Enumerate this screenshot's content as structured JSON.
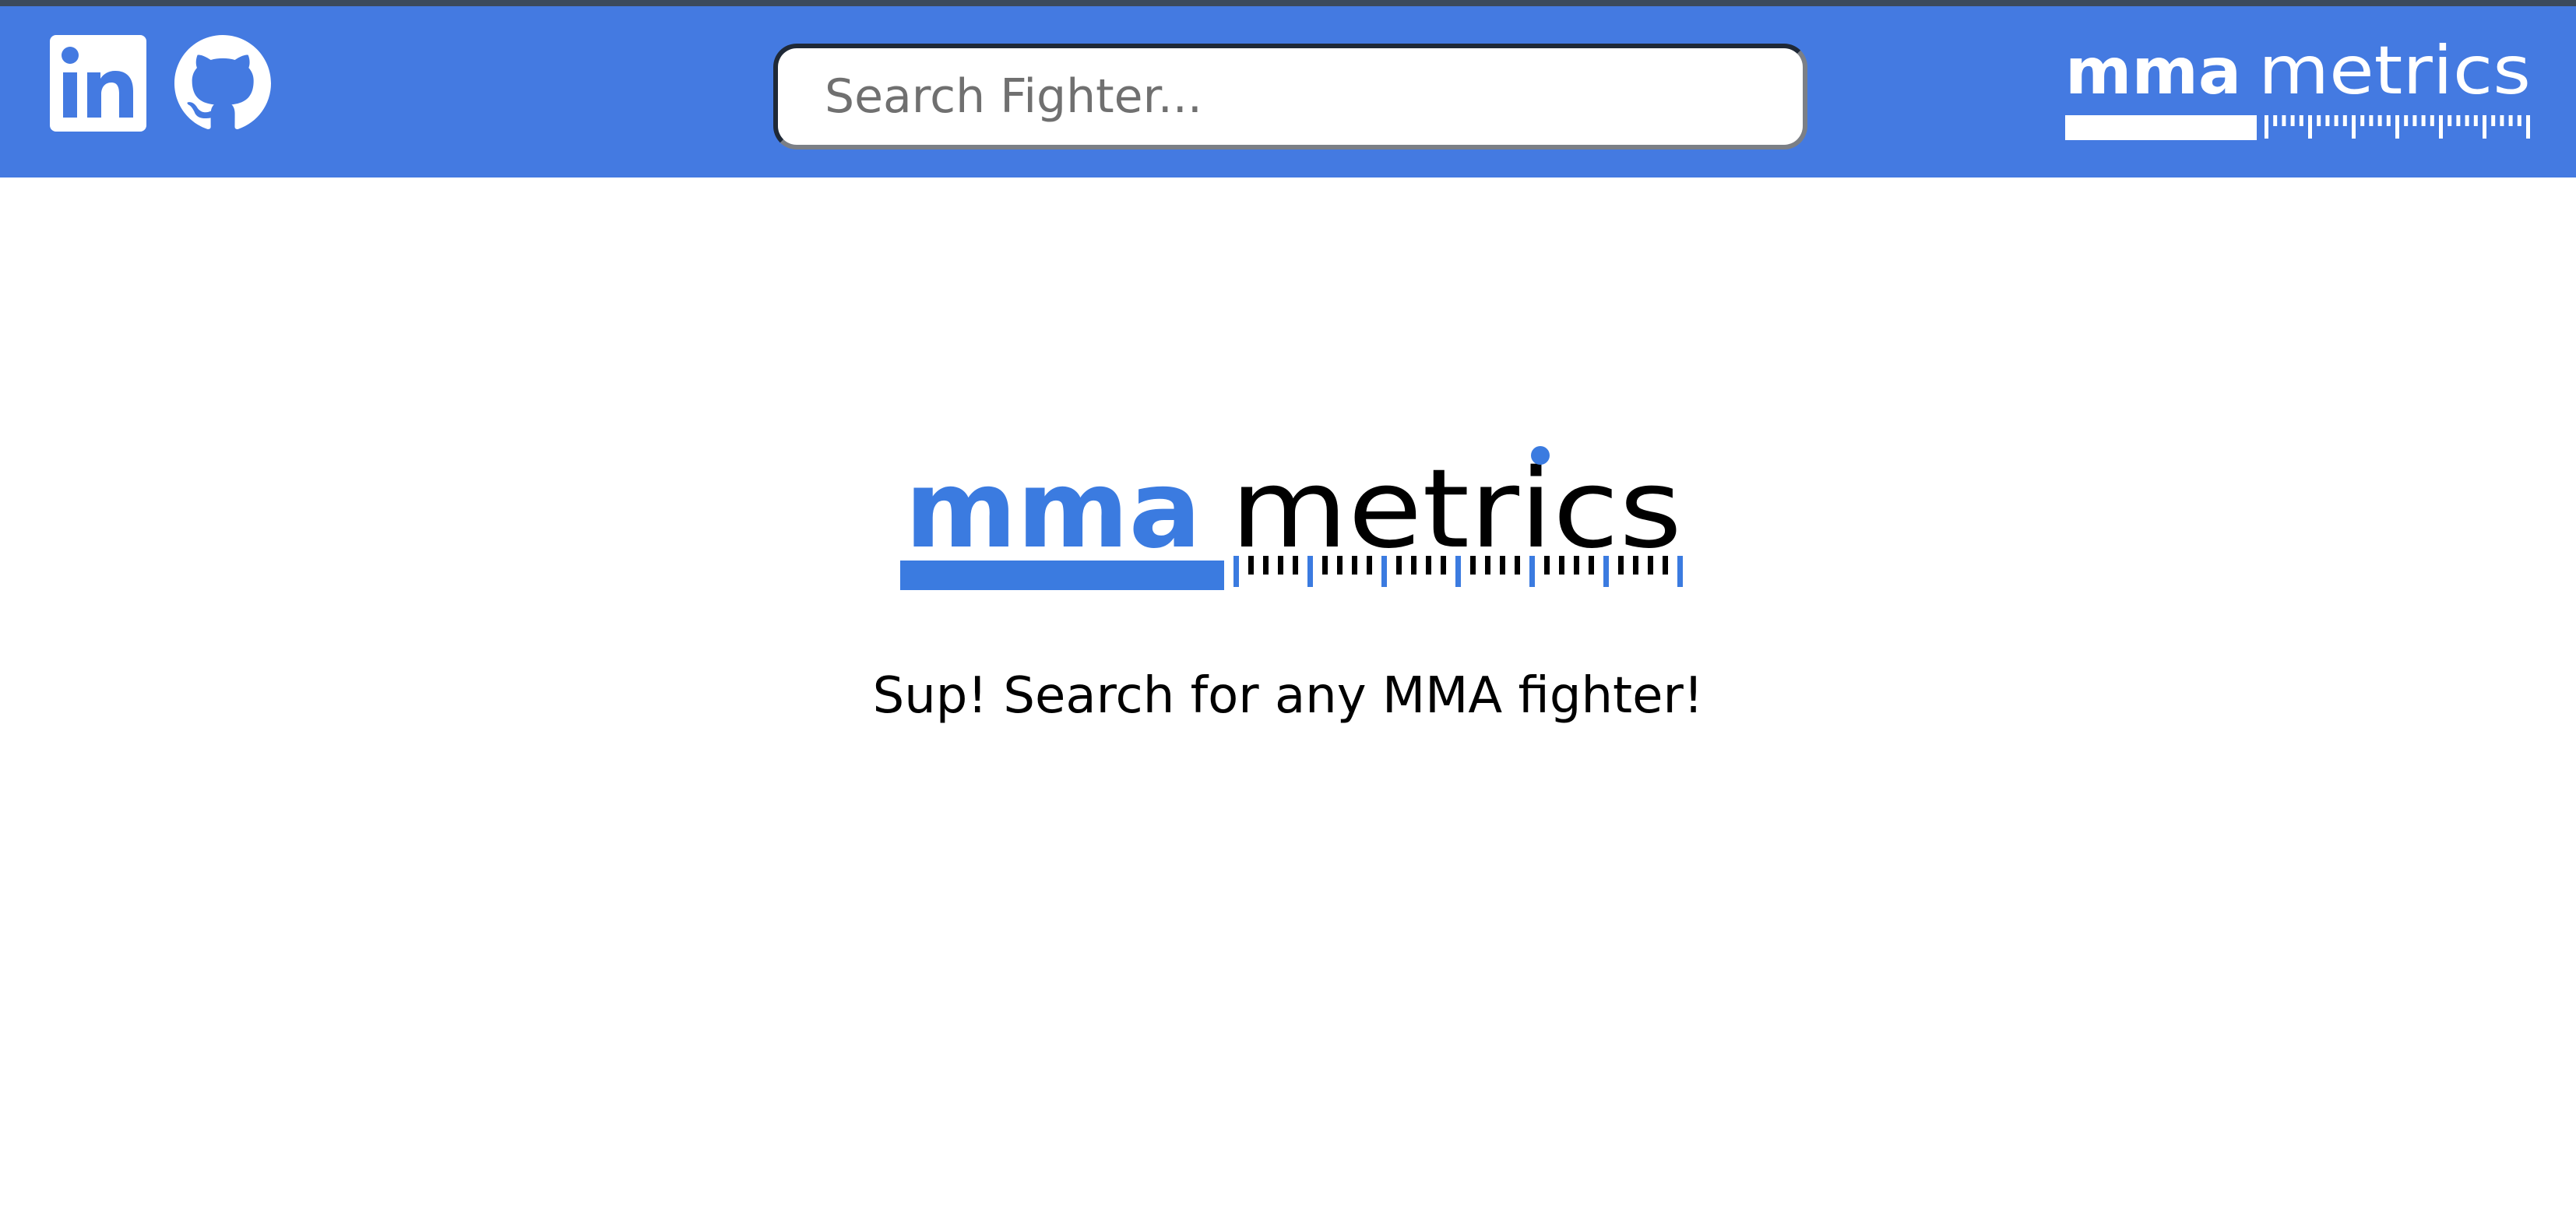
{
  "navbar": {
    "background_color": "#447ae1",
    "linkedin_icon": "linkedin-icon",
    "github_icon": "github-icon"
  },
  "search": {
    "placeholder": "Search Fighter...",
    "value": ""
  },
  "brand": {
    "logo_text_bold": "mma",
    "logo_text_light": "metrics",
    "accent_color": "#3b7be0"
  },
  "main": {
    "tagline": "Sup! Search for any MMA fighter!"
  }
}
